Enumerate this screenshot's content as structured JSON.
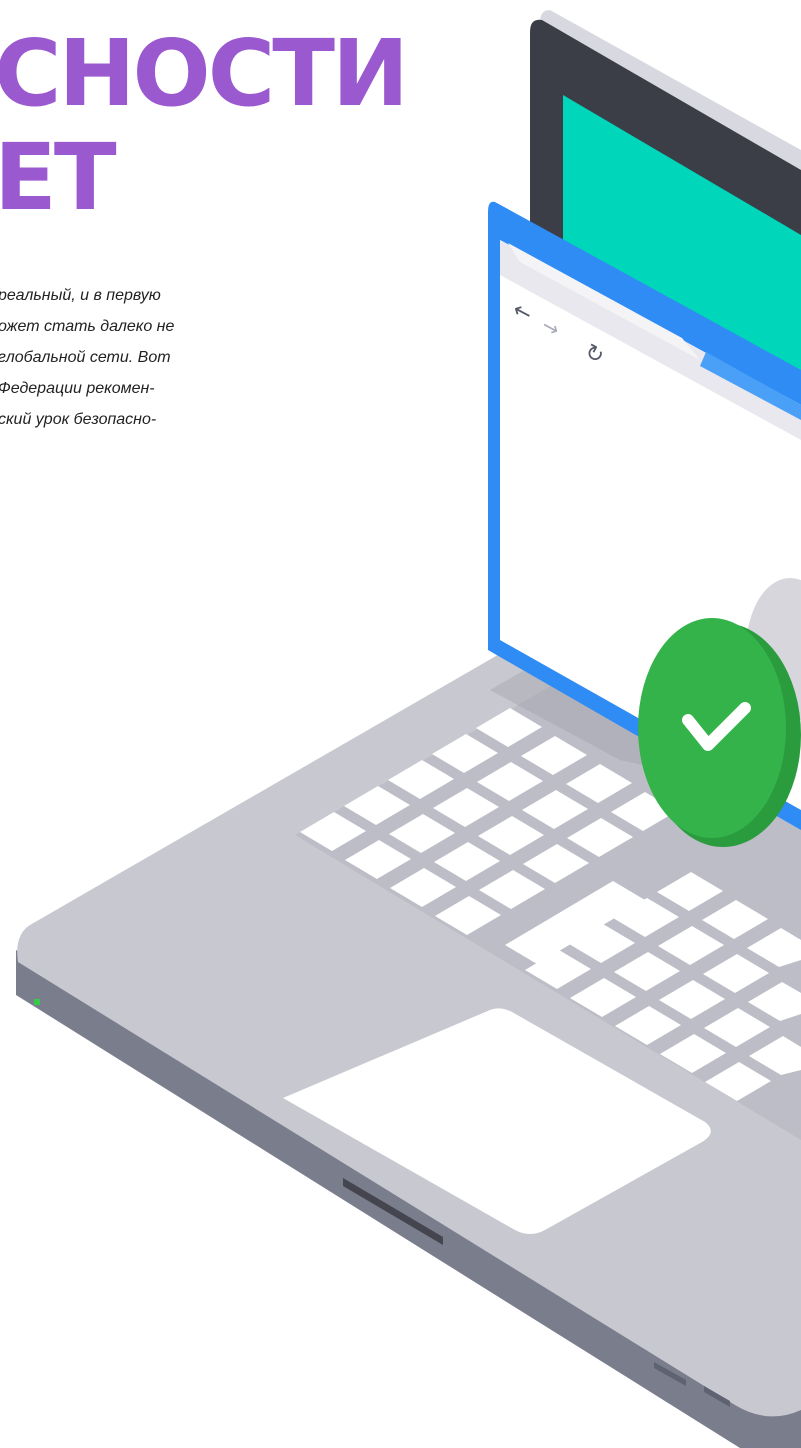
{
  "hero": {
    "headline_line1": "СНОСТИ",
    "headline_line2": "ЕТ",
    "body_lines": [
      "реальный, и в первую",
      "ожет стать далеко не",
      "глобальной сети. Вот",
      "Федерации рекомен-",
      "ский урок безопасно-"
    ]
  },
  "colors": {
    "headline": "#9b59d0",
    "screen_bezel": "#3b3d47",
    "screen": "#00d6b9",
    "browser_frame": "#2f8cf5",
    "check_badge": "#33b34a",
    "laptop_body": "#c8c8d0",
    "laptop_edge": "#7a7d8c",
    "keys": "#ffffff"
  },
  "illustration": {
    "icons": [
      "arrow-left-icon",
      "arrow-right-icon",
      "reload-icon",
      "check-icon",
      "power-led-icon"
    ]
  }
}
